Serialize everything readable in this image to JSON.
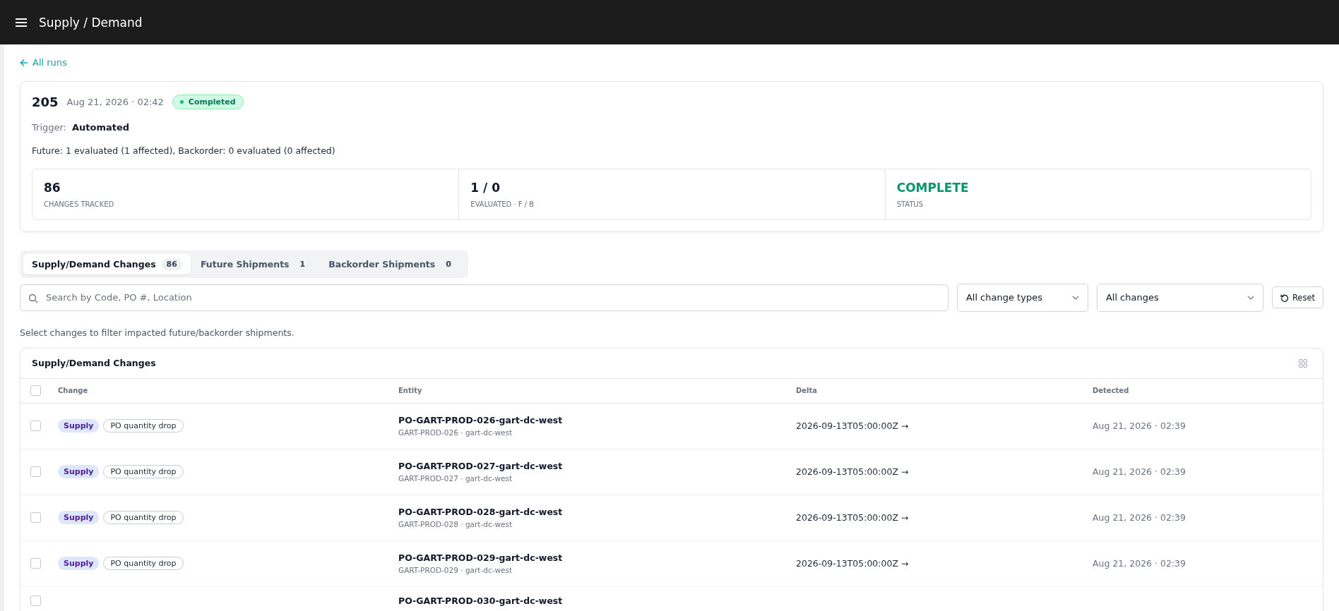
{
  "app_bar": {
    "title": "Supply / Demand"
  },
  "back_link": {
    "label": "All runs"
  },
  "run": {
    "number": "205",
    "date": "Aug 21, 2026 · 02:42",
    "status": {
      "label": "Completed",
      "kind": "success"
    },
    "trigger_label": "Trigger:",
    "trigger_value": "Automated",
    "summary": "Future: 1 evaluated (1 affected), Backorder: 0 evaluated (0 affected)",
    "stats": [
      {
        "value": "86",
        "label": "CHANGES TRACKED",
        "color": "#111827"
      },
      {
        "value": "1 / 0",
        "label": "EVALUATED · F / B",
        "color": "#111827"
      },
      {
        "value": "COMPLETE",
        "label": "STATUS",
        "color": "#059669"
      }
    ]
  },
  "tabs": [
    {
      "label": "Supply/Demand Changes",
      "count": "86",
      "selected": true
    },
    {
      "label": "Future Shipments",
      "count": "1",
      "selected": false
    },
    {
      "label": "Backorder Shipments",
      "count": "0",
      "selected": false
    }
  ],
  "filters": {
    "search": {
      "placeholder": "Search by Code, PO #, Location"
    },
    "type_select": "All change types",
    "change_select": "All changes",
    "reset": "Reset"
  },
  "hint": "Select changes to filter impacted future/backorder shipments.",
  "table": {
    "title": "Supply/Demand Changes",
    "select_all": {
      "checked": false
    },
    "columns": [
      "Change",
      "Entity",
      "Delta",
      "Detected"
    ],
    "rows": [
      {
        "checked": false,
        "tag": "Supply",
        "change": "PO quantity drop",
        "entity": "PO-GART-PROD-026-gart-dc-west",
        "entity_sub": "GART-PROD-026 · gart-dc-west",
        "delta": "2026-09-13T05:00:00Z →",
        "detected": "Aug 21, 2026 · 02:39"
      },
      {
        "checked": false,
        "tag": "Supply",
        "change": "PO quantity drop",
        "entity": "PO-GART-PROD-027-gart-dc-west",
        "entity_sub": "GART-PROD-027 · gart-dc-west",
        "delta": "2026-09-13T05:00:00Z →",
        "detected": "Aug 21, 2026 · 02:39"
      },
      {
        "checked": false,
        "tag": "Supply",
        "change": "PO quantity drop",
        "entity": "PO-GART-PROD-028-gart-dc-west",
        "entity_sub": "GART-PROD-028 · gart-dc-west",
        "delta": "2026-09-13T05:00:00Z →",
        "detected": "Aug 21, 2026 · 02:39"
      },
      {
        "checked": false,
        "tag": "Supply",
        "change": "PO quantity drop",
        "entity": "PO-GART-PROD-029-gart-dc-west",
        "entity_sub": "GART-PROD-029 · gart-dc-west",
        "delta": "2026-09-13T05:00:00Z →",
        "detected": "Aug 21, 2026 · 02:39"
      },
      {
        "checked": false,
        "entity": "PO-GART-PROD-030-gart-dc-west"
      }
    ]
  }
}
